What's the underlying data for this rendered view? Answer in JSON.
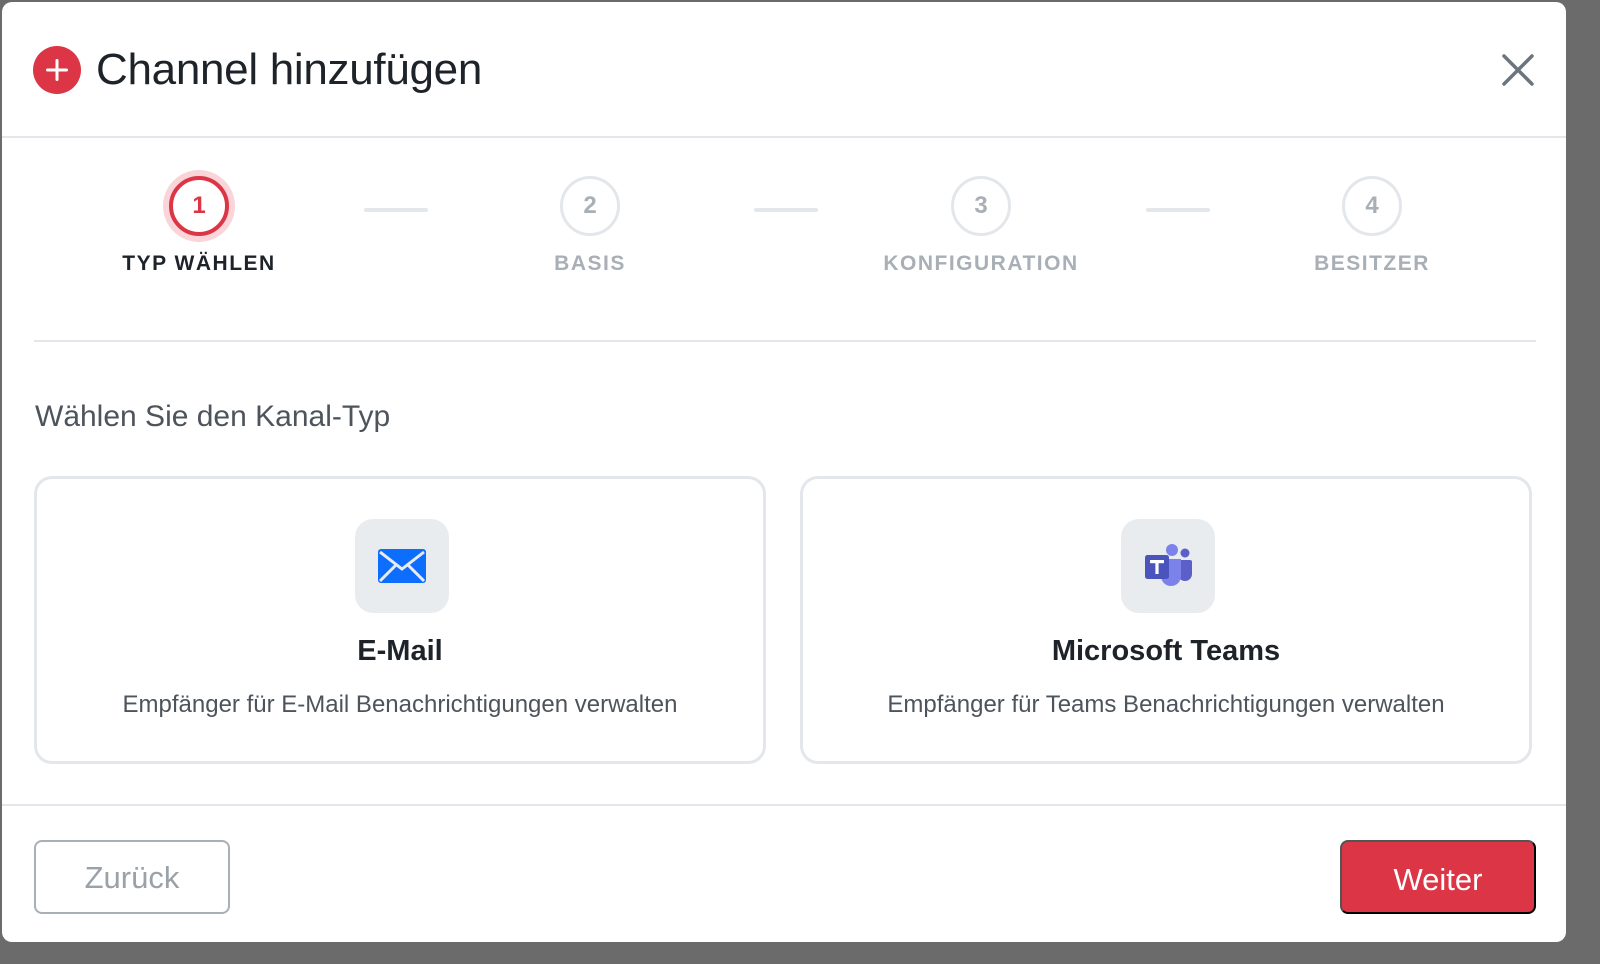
{
  "dialog": {
    "title": "Channel hinzufügen",
    "title_icon": "plus-circle-icon",
    "close_icon": "close-icon",
    "accent_color": "#dc3545"
  },
  "stepper": {
    "steps": [
      {
        "number": "1",
        "label": "TYP WÄHLEN",
        "state": "active"
      },
      {
        "number": "2",
        "label": "BASIS",
        "state": "inactive"
      },
      {
        "number": "3",
        "label": "KONFIGURATION",
        "state": "inactive"
      },
      {
        "number": "4",
        "label": "BESITZER",
        "state": "inactive"
      }
    ]
  },
  "main": {
    "prompt": "Wählen Sie den Kanal-Typ",
    "cards": [
      {
        "icon": "envelope-icon",
        "icon_color": "#0d6efd",
        "title": "E-Mail",
        "description": "Empfänger für E-Mail Benachrichtigungen verwalten"
      },
      {
        "icon": "microsoft-teams-icon",
        "icon_color": "#5b5fc7",
        "title": "Microsoft Teams",
        "description": "Empfänger für Teams Benachrichtigungen verwalten"
      }
    ]
  },
  "footer": {
    "back_label": "Zurück",
    "next_label": "Weiter"
  }
}
